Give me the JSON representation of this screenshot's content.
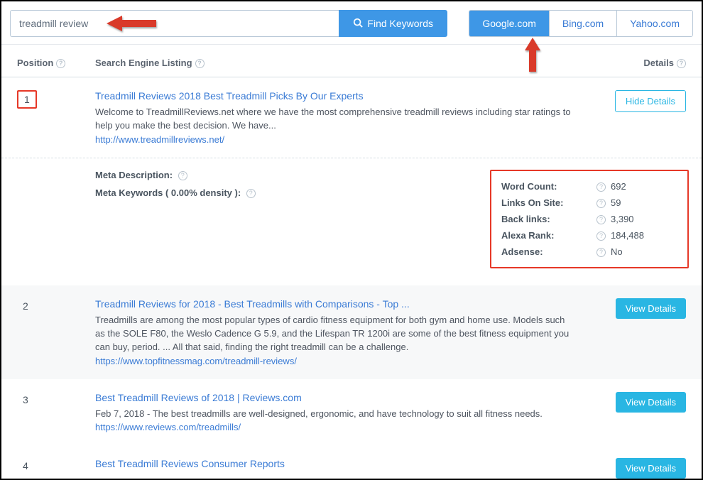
{
  "search": {
    "value": "treadmill review",
    "find_label": "Find Keywords"
  },
  "engines": [
    {
      "label": "Google.com",
      "active": true
    },
    {
      "label": "Bing.com",
      "active": false
    },
    {
      "label": "Yahoo.com",
      "active": false
    }
  ],
  "headers": {
    "position": "Position",
    "listing": "Search Engine Listing",
    "details": "Details"
  },
  "results": [
    {
      "position": "1",
      "title": "Treadmill Reviews 2018 Best Treadmill Picks By Our Experts",
      "desc": "Welcome to TreadmillReviews.net where we have the most comprehensive treadmill reviews including star ratings to help you make the best decision. We have...",
      "url": "http://www.treadmillreviews.net/",
      "expanded": true,
      "button": "Hide Details",
      "meta": {
        "desc_label": "Meta Description:",
        "kw_label": "Meta Keywords ( 0.00% density ):"
      },
      "stats": [
        {
          "label": "Word Count:",
          "value": "692"
        },
        {
          "label": "Links On Site:",
          "value": "59"
        },
        {
          "label": "Back links:",
          "value": "3,390"
        },
        {
          "label": "Alexa Rank:",
          "value": "184,488"
        },
        {
          "label": "Adsense:",
          "value": "No"
        }
      ]
    },
    {
      "position": "2",
      "title": "Treadmill Reviews for 2018 - Best Treadmills with Comparisons - Top ...",
      "desc": "Treadmills are among the most popular types of cardio fitness equipment for both gym and home use. Models such as the SOLE F80, the Weslo Cadence G 5.9, and the Lifespan TR 1200i are some of the best fitness equipment you can buy, period. ... All that said, finding the right treadmill can be a challenge.",
      "url": "https://www.topfitnessmag.com/treadmill-reviews/",
      "button": "View Details"
    },
    {
      "position": "3",
      "title": "Best Treadmill Reviews of 2018 | Reviews.com",
      "desc": "Feb 7, 2018 - The best treadmills are well-designed, ergonomic, and have technology to suit all fitness needs.",
      "url": "https://www.reviews.com/treadmills/",
      "button": "View Details"
    },
    {
      "position": "4",
      "title": "Best Treadmill Reviews Consumer Reports",
      "button": "View Details"
    }
  ]
}
